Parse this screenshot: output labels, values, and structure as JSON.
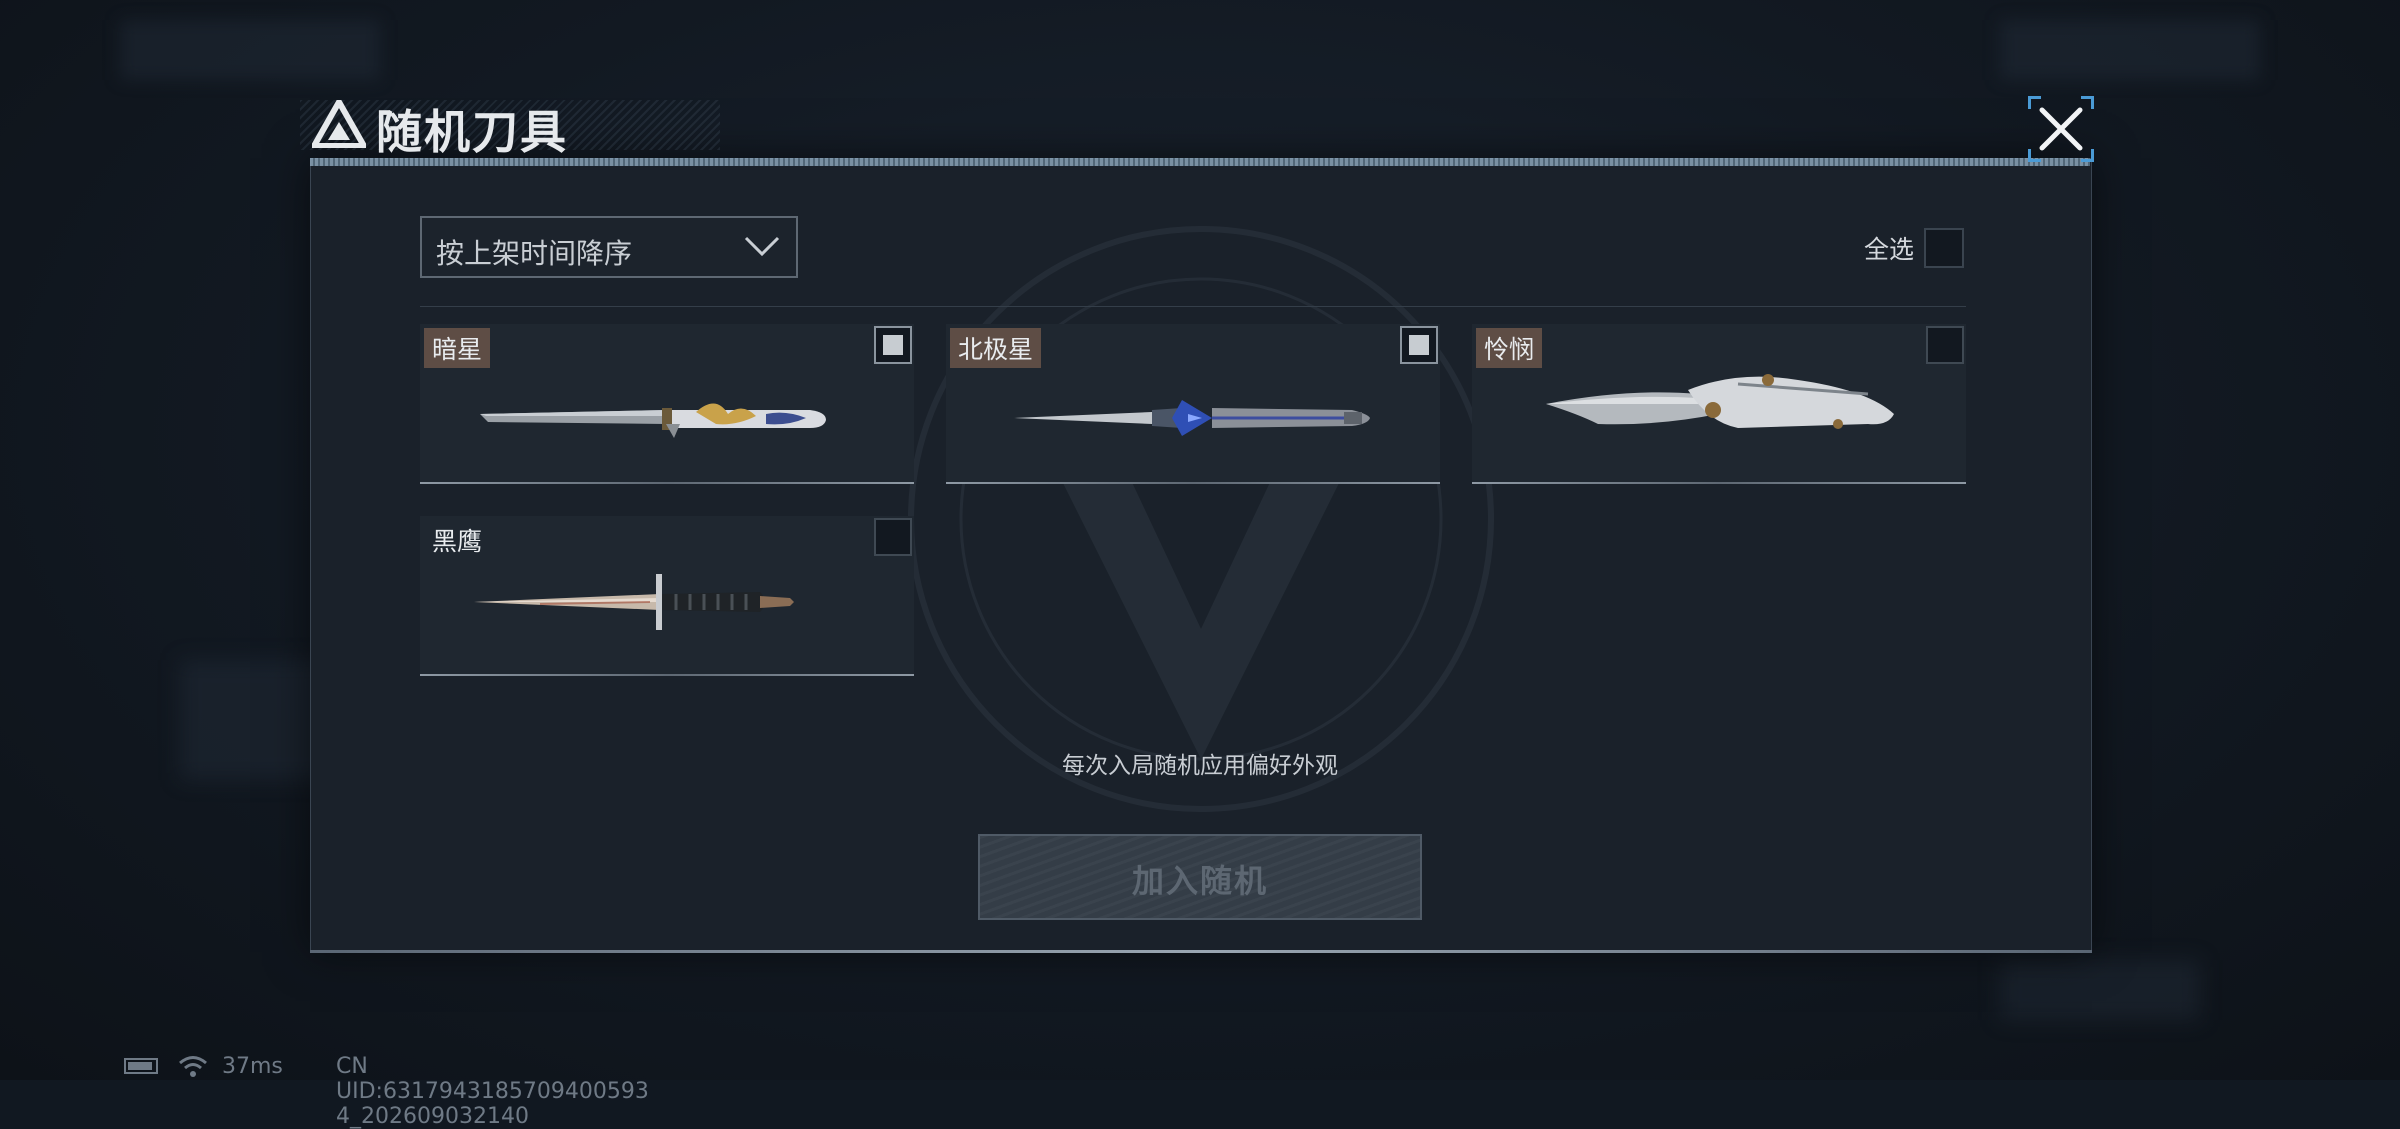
{
  "dialog": {
    "title": "随机刀具",
    "close_label": "关闭"
  },
  "toolbar": {
    "sort_label": "按上架时间降序",
    "select_all_label": "全选",
    "select_all_checked": false
  },
  "knives": [
    {
      "name": "暗星",
      "checked": true,
      "tag_style": "highlight",
      "icon": "gold-dagger-icon"
    },
    {
      "name": "北极星",
      "checked": true,
      "tag_style": "highlight",
      "icon": "blue-stiletto-icon"
    },
    {
      "name": "怜悯",
      "checked": false,
      "tag_style": "highlight",
      "icon": "folding-knife-icon"
    },
    {
      "name": "黑鹰",
      "checked": false,
      "tag_style": "plain",
      "icon": "combat-knife-icon"
    }
  ],
  "hint": "每次入局随机应用偏好外观",
  "add_button_label": "加入随机",
  "statusbar": {
    "ping": "37ms",
    "uid": "CN UID:6317943185709400593​4_202609032140"
  },
  "colors": {
    "tag_bg": "#5e4d45",
    "accent_line": "#8aa3b8",
    "button_disabled_text": "#5d6772"
  }
}
